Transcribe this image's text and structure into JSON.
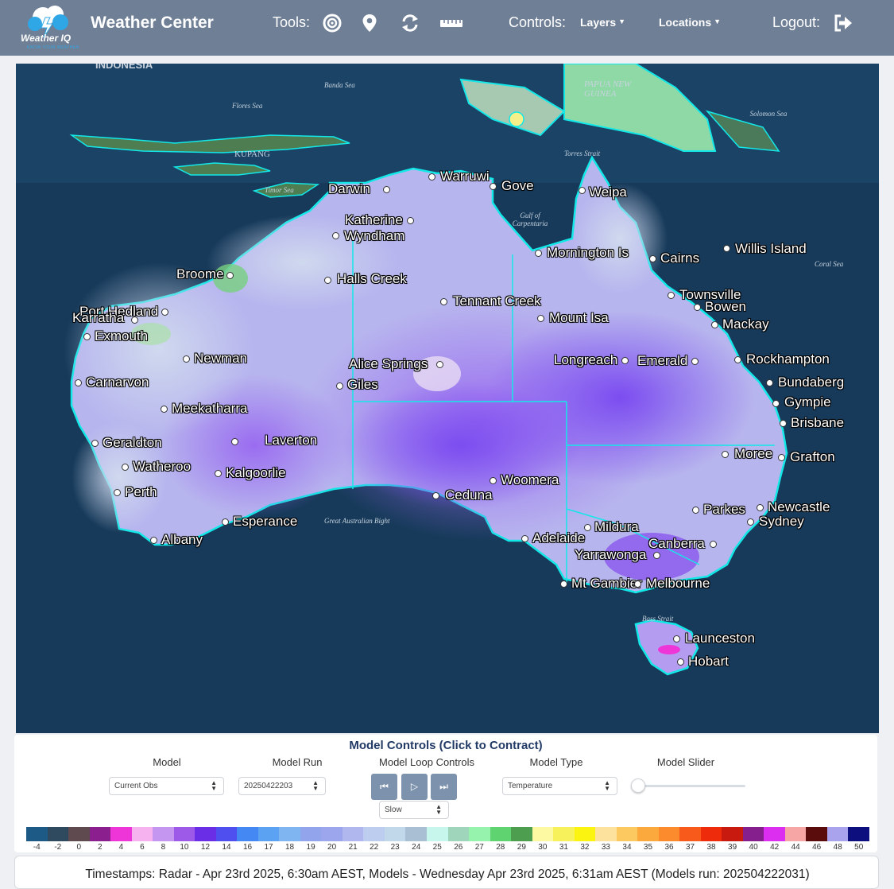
{
  "header": {
    "brand": "Weather Center",
    "logo_text": "Weather IQ",
    "logo_tagline": "KNOW YOUR WEATHER",
    "tools_label": "Tools:",
    "tools": [
      {
        "name": "radar-target-icon"
      },
      {
        "name": "location-pin-icon"
      },
      {
        "name": "refresh-icon"
      },
      {
        "name": "ruler-icon"
      }
    ],
    "controls_label": "Controls:",
    "layers_label": "Layers",
    "locations_label": "Locations",
    "logout_label": "Logout:",
    "colors": {
      "header_bg": "#6f7f96",
      "logo_accent": "#2fa7e6"
    }
  },
  "map": {
    "region_labels": [
      "INDONESIA",
      "Banda Sea",
      "Flores Sea",
      "Timor Sea",
      "Gulf of Carpentaria",
      "Torres Strait",
      "Solomon Sea",
      "Coral Sea",
      "Great Australian Bight",
      "Bass Strait",
      "PAPUA NEW GUINEA",
      "KUPANG"
    ],
    "cities": [
      "Darwin",
      "Warruwi",
      "Gove",
      "Weipa",
      "Katherine",
      "Wyndham",
      "Mornington Is",
      "Cairns",
      "Willis Island",
      "Broome",
      "Halls Creek",
      "Tennant Creek",
      "Townsville",
      "Bowen",
      "Port Hedland",
      "Karratha",
      "Mount Isa",
      "Mackay",
      "Exmouth",
      "Newman",
      "Alice Springs",
      "Longreach",
      "Emerald",
      "Rockhampton",
      "Carnarvon",
      "Giles",
      "Bundaberg",
      "Meekatharra",
      "Gympie",
      "Brisbane",
      "Geraldton",
      "Laverton",
      "Moree",
      "Grafton",
      "Watheroo",
      "Kalgoorlie",
      "Woomera",
      "Perth",
      "Ceduna",
      "Parkes",
      "Newcastle",
      "Esperance",
      "Sydney",
      "Mildura",
      "Albany",
      "Adelaide",
      "Canberra",
      "Yarrawonga",
      "Mt Gambier",
      "Melbourne",
      "Launceston",
      "Hobart"
    ]
  },
  "panel": {
    "title": "Model Controls (Click to Contract)",
    "model_label": "Model",
    "model_value": "Current Obs",
    "run_label": "Model Run",
    "run_value": "20250422203",
    "loop_label": "Model Loop Controls",
    "loop_speed": "Slow",
    "type_label": "Model Type",
    "type_value": "Temperature",
    "slider_label": "Model Slider",
    "slider_value": 0
  },
  "legend": [
    {
      "label": "-4",
      "color": "#1d5a85"
    },
    {
      "label": "-2",
      "color": "#2f4a5e"
    },
    {
      "label": "0",
      "color": "#5e4a4f"
    },
    {
      "label": "2",
      "color": "#8c1f8e"
    },
    {
      "label": "4",
      "color": "#ee36d8"
    },
    {
      "label": "6",
      "color": "#f6b2ef"
    },
    {
      "label": "8",
      "color": "#c596f0"
    },
    {
      "label": "10",
      "color": "#9d5ae9"
    },
    {
      "label": "12",
      "color": "#6a2ee6"
    },
    {
      "label": "14",
      "color": "#4f4ff0"
    },
    {
      "label": "16",
      "color": "#4489f3"
    },
    {
      "label": "17",
      "color": "#5ca2f3"
    },
    {
      "label": "18",
      "color": "#7fb6f2"
    },
    {
      "label": "19",
      "color": "#92a5ec"
    },
    {
      "label": "20",
      "color": "#9ca6ec"
    },
    {
      "label": "21",
      "color": "#b0b7ef"
    },
    {
      "label": "22",
      "color": "#bccdf0"
    },
    {
      "label": "23",
      "color": "#c1d7ea"
    },
    {
      "label": "24",
      "color": "#a9bfd4"
    },
    {
      "label": "25",
      "color": "#c7f7ec"
    },
    {
      "label": "26",
      "color": "#9fd6bb"
    },
    {
      "label": "27",
      "color": "#95f3ae"
    },
    {
      "label": "28",
      "color": "#5ed36f"
    },
    {
      "label": "29",
      "color": "#4d9f4f"
    },
    {
      "label": "30",
      "color": "#fdf9a2"
    },
    {
      "label": "31",
      "color": "#f7f25c"
    },
    {
      "label": "32",
      "color": "#fbf410"
    },
    {
      "label": "33",
      "color": "#fde29e"
    },
    {
      "label": "34",
      "color": "#fbc95f"
    },
    {
      "label": "35",
      "color": "#fba83c"
    },
    {
      "label": "36",
      "color": "#fb8b2c"
    },
    {
      "label": "37",
      "color": "#f85a1c"
    },
    {
      "label": "38",
      "color": "#ee2c0c"
    },
    {
      "label": "39",
      "color": "#c91a10"
    },
    {
      "label": "40",
      "color": "#861f8e"
    },
    {
      "label": "42",
      "color": "#dc2ef1"
    },
    {
      "label": "44",
      "color": "#f7a6a6"
    },
    {
      "label": "46",
      "color": "#5a0c0c"
    },
    {
      "label": "48",
      "color": "#a9a3ee"
    },
    {
      "label": "50",
      "color": "#0d0f7e"
    }
  ],
  "footer": {
    "timestamps": "Timestamps: Radar - Apr 23rd 2025, 6:30am AEST,  Models - Wednesday Apr 23rd 2025, 6:31am AEST (Models run: 202504222031)"
  }
}
